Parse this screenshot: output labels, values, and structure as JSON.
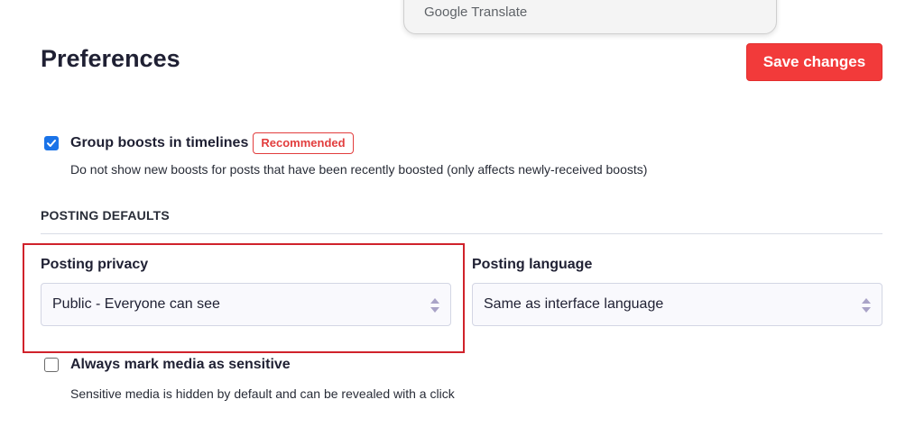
{
  "translate_popup": {
    "brand": "Google",
    "product": "Translate"
  },
  "page": {
    "title": "Preferences",
    "save_label": "Save changes"
  },
  "group_boosts": {
    "label": "Group boosts in timelines",
    "badge": "Recommended",
    "checked": true,
    "hint": "Do not show new boosts for posts that have been recently boosted (only affects newly-received boosts)"
  },
  "posting_defaults": {
    "section_title": "POSTING DEFAULTS",
    "privacy": {
      "label": "Posting privacy",
      "value": "Public - Everyone can see"
    },
    "language": {
      "label": "Posting language",
      "value": "Same as interface language"
    }
  },
  "sensitive_media": {
    "label": "Always mark media as sensitive",
    "checked": false,
    "hint": "Sensitive media is hidden by default and can be revealed with a click"
  },
  "colors": {
    "accent": "#f23a3a",
    "checkbox": "#1a73e8",
    "highlight": "#d0222b",
    "badge": "#e23d3d"
  },
  "icons": {
    "checkbox_checked": "check-icon",
    "select_arrows": "up-down-arrows-icon"
  }
}
